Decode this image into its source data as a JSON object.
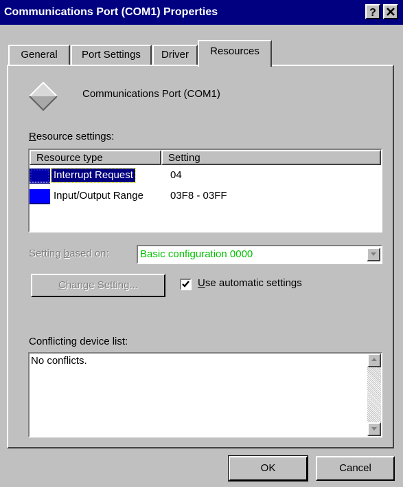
{
  "window": {
    "title": "Communications Port (COM1) Properties",
    "help_button": "?",
    "close_button": "✕"
  },
  "tabs": [
    {
      "label": "General"
    },
    {
      "label": "Port Settings"
    },
    {
      "label": "Driver"
    },
    {
      "label": "Resources"
    }
  ],
  "device": {
    "icon": "port-diamond-icon",
    "name": "Communications Port (COM1)"
  },
  "resource_settings": {
    "label": "Resource settings:",
    "columns": [
      "Resource type",
      "Setting"
    ],
    "rows": [
      {
        "type": "Interrupt Request",
        "setting": "04",
        "selected": true
      },
      {
        "type": "Input/Output Range",
        "setting": "03F8 - 03FF",
        "selected": false
      }
    ]
  },
  "setting_based_on": {
    "label": "Setting based on:",
    "value": "Basic configuration 0000"
  },
  "change_setting_button": "Change Setting...",
  "use_automatic": {
    "label": "Use automatic settings",
    "checked": true
  },
  "conflicts": {
    "label": "Conflicting device list:",
    "text": "No conflicts."
  },
  "buttons": {
    "ok": "OK",
    "cancel": "Cancel"
  },
  "colors": {
    "title_bar": "#000080",
    "selection": "#000080",
    "icon_blue": "#0000ff",
    "value_green": "#00c000"
  }
}
